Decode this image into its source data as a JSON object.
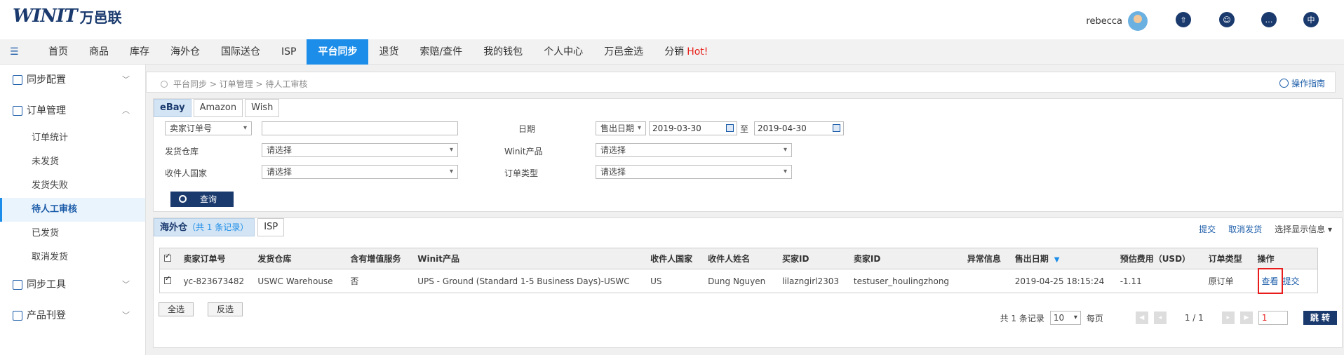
{
  "header": {
    "logo_mark": "WINIT",
    "logo_cn": "万邑联",
    "user_name": "rebecca",
    "icons": [
      "upload-icon",
      "support-icon",
      "chat-icon",
      "language-icon"
    ],
    "language_label": "中"
  },
  "nav": {
    "items": [
      "首页",
      "商品",
      "库存",
      "海外仓",
      "国际送仓",
      "ISP",
      "平台同步",
      "退货",
      "索赔/查件",
      "我的钱包",
      "个人中心",
      "万邑金选",
      "分销"
    ],
    "active": "平台同步",
    "hot_label": "Hot!"
  },
  "sidebar": {
    "group_sync_config": "同步配置",
    "group_order_mgmt": "订单管理",
    "order_items": [
      "订单统计",
      "未发货",
      "发货失败",
      "待人工审核",
      "已发货",
      "取消发货"
    ],
    "active_item": "待人工审核",
    "group_sync_tools": "同步工具",
    "group_product_listing": "产品刊登"
  },
  "breadcrumb": {
    "text": "平台同步 > 订单管理 > 待人工审核",
    "guide": "操作指南"
  },
  "filter": {
    "tabs": [
      "eBay",
      "Amazon",
      "Wish"
    ],
    "active_tab": "eBay",
    "order_no_select": "卖家订单号",
    "order_no_value": "",
    "date_label": "日期",
    "date_type": "售出日期",
    "date_from": "2019-03-30",
    "date_to_label": "至",
    "date_to": "2019-04-30",
    "warehouse_label": "发货仓库",
    "warehouse_value": "请选择",
    "winit_product_label": "Winit产品",
    "winit_product_value": "请选择",
    "country_label": "收件人国家",
    "country_value": "请选择",
    "order_type_label": "订单类型",
    "order_type_value": "请选择",
    "search_button": "查询"
  },
  "results": {
    "tab_overseas": "海外仓",
    "tab_overseas_count": "（共 1 条记录）",
    "tab_isp": "ISP",
    "actions": {
      "submit": "提交",
      "cancel_shipping": "取消发货",
      "choose_columns": "选择显示信息 ▾"
    },
    "columns": [
      "卖家订单号",
      "发货仓库",
      "含有增值服务",
      "Winit产品",
      "收件人国家",
      "收件人姓名",
      "买家ID",
      "卖家ID",
      "异常信息",
      "售出日期",
      "预估费用（USD）",
      "订单类型",
      "操作"
    ],
    "rows": [
      {
        "order_no": "yc-823673482",
        "warehouse": "USWC Warehouse",
        "value_added": "否",
        "winit_product": "UPS - Ground (Standard 1-5 Business Days)-USWC",
        "country": "US",
        "recipient": "Dung Nguyen",
        "buyer_id": "lilazngirl2303",
        "seller_id": "testuser_houlingzhong",
        "exception": "",
        "sold_date": "2019-04-25 18:15:24",
        "est_fee": "-1.11",
        "order_type": "原订单",
        "op_view": "查看",
        "op_submit": "提交"
      }
    ],
    "select_all": "全选",
    "invert_select": "反选"
  },
  "pager": {
    "total_text": "共 1 条记录",
    "page_size": "10",
    "per_page": "每页",
    "page_info": "1 / 1",
    "page_input": "1",
    "jump": "跳 转"
  }
}
